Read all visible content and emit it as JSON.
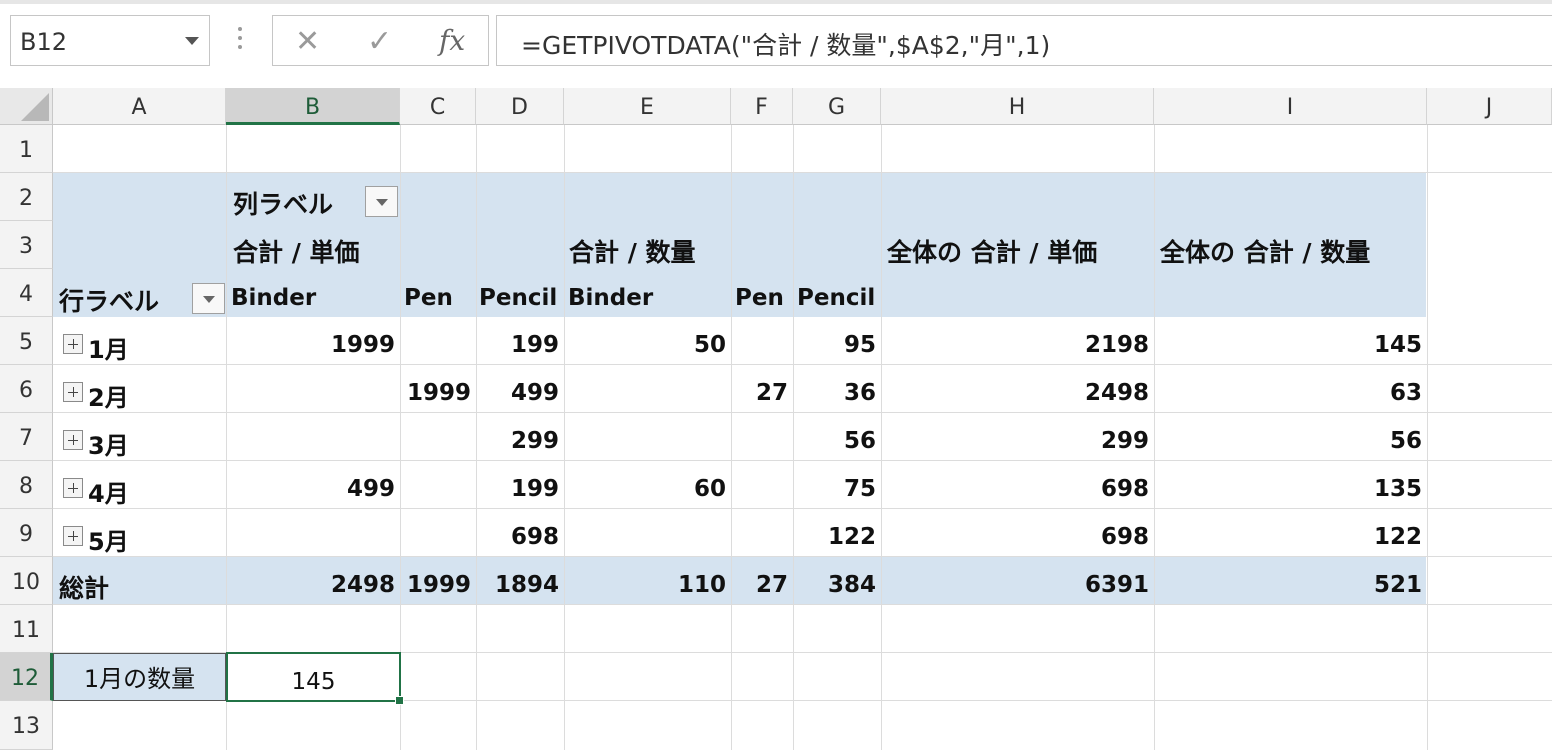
{
  "formula_bar": {
    "name_box": "B12",
    "cancel_icon": "✕",
    "enter_icon": "✓",
    "fx_label": "fx",
    "formula": "=GETPIVOTDATA(\"合計 / 数量\",$A$2,\"月\",1)"
  },
  "columns": [
    "A",
    "B",
    "C",
    "D",
    "E",
    "F",
    "G",
    "H",
    "I",
    "J"
  ],
  "rows": [
    "1",
    "2",
    "3",
    "4",
    "5",
    "6",
    "7",
    "8",
    "9",
    "10",
    "11",
    "12",
    "13"
  ],
  "selected_column": "B",
  "selected_row": "12",
  "pivot": {
    "column_labels": "列ラベル",
    "row_labels": "行ラベル",
    "sum_price": "合計 / 単価",
    "sum_qty": "合計 / 数量",
    "total_sum_price": "全体の 合計 / 単価",
    "total_sum_qty": "全体の 合計 / 数量",
    "products": [
      "Binder",
      "Pen",
      "Pencil",
      "Binder",
      "Pen",
      "Pencil"
    ],
    "data_rows": [
      {
        "label": "1月",
        "values": [
          "1999",
          "",
          "199",
          "50",
          "",
          "95",
          "2198",
          "145"
        ]
      },
      {
        "label": "2月",
        "values": [
          "",
          "1999",
          "499",
          "",
          "27",
          "36",
          "2498",
          "63"
        ]
      },
      {
        "label": "3月",
        "values": [
          "",
          "",
          "299",
          "",
          "",
          "56",
          "299",
          "56"
        ]
      },
      {
        "label": "4月",
        "values": [
          "499",
          "",
          "199",
          "60",
          "",
          "75",
          "698",
          "135"
        ]
      },
      {
        "label": "5月",
        "values": [
          "",
          "",
          "698",
          "",
          "",
          "122",
          "698",
          "122"
        ]
      }
    ],
    "grand_total": {
      "label": "総計",
      "values": [
        "2498",
        "1999",
        "1894",
        "110",
        "27",
        "384",
        "6391",
        "521"
      ]
    }
  },
  "a12": "1月の数量",
  "b12": "145",
  "colors": {
    "pivot_band": "#d5e3f0",
    "selection": "#217346"
  }
}
